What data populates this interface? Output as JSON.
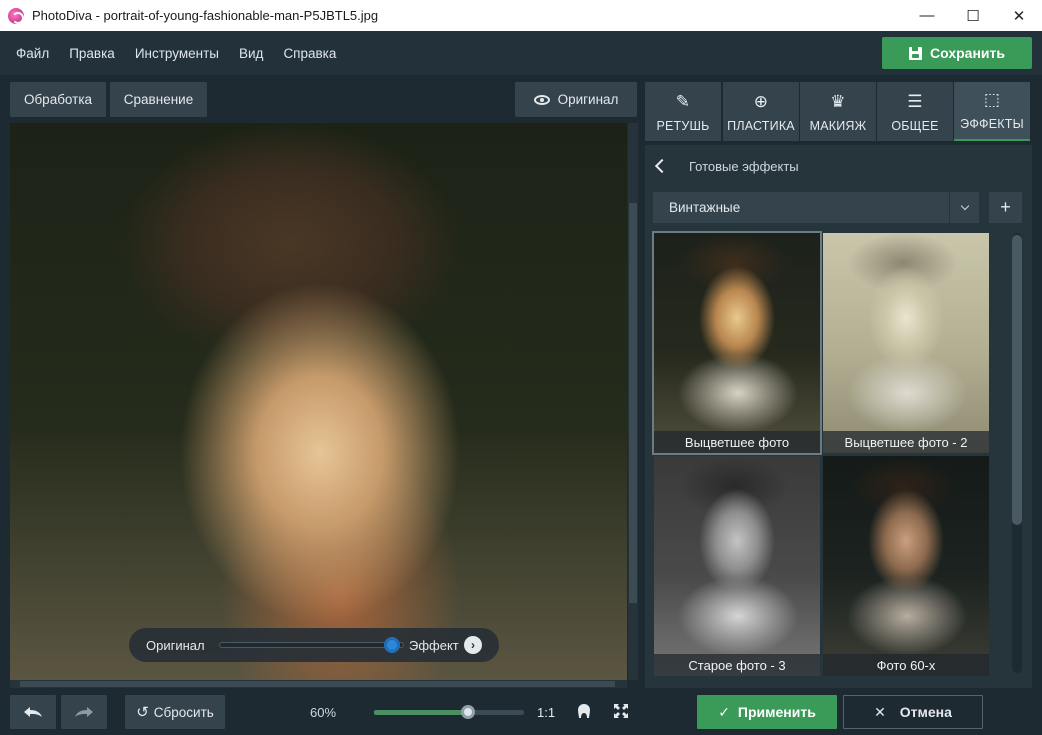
{
  "window": {
    "title": "PhotoDiva - portrait-of-young-fashionable-man-P5JBTL5.jpg",
    "minimize": "—",
    "maximize": "☐",
    "close": "✕"
  },
  "menu": {
    "items": [
      "Файл",
      "Правка",
      "Инструменты",
      "Вид",
      "Справка"
    ],
    "save_label": "Сохранить"
  },
  "toolbar": {
    "processing": "Обработка",
    "comparison": "Сравнение",
    "original": "Оригинал"
  },
  "compare": {
    "original_label": "Оригинал",
    "effect_label": "Эффект",
    "position": 0.95
  },
  "bottom": {
    "reset_label": "Сбросить",
    "zoom": "60%",
    "zoom_fraction": 0.6,
    "one_to_one": "1:1",
    "apply_label": "Применить",
    "cancel_label": "Отмена",
    "apply_icon": "check-icon",
    "cancel_icon": "close-icon"
  },
  "tabs": [
    {
      "label": "РЕТУШЬ",
      "icon": "retouch-icon"
    },
    {
      "label": "ПЛАСТИКА",
      "icon": "plastic-icon"
    },
    {
      "label": "МАКИЯЖ",
      "icon": "makeup-icon"
    },
    {
      "label": "ОБЩЕЕ",
      "icon": "sliders-icon"
    },
    {
      "label": "ЭФФЕКТЫ",
      "icon": "effects-icon",
      "active": true
    }
  ],
  "panel": {
    "title": "Готовые эффекты",
    "category": "Винтажные",
    "add": "+",
    "effects": [
      {
        "label": "Выцветшее фото",
        "selected": true
      },
      {
        "label": "Выцветшее фото - 2"
      },
      {
        "label": "Старое фото - 3"
      },
      {
        "label": "Фото 60-х"
      }
    ]
  },
  "colors": {
    "accent": "#3a9a57",
    "background": "#1e2a31",
    "panel": "#26343c",
    "button": "#34434c",
    "slider_knob": "#2f86d6"
  }
}
